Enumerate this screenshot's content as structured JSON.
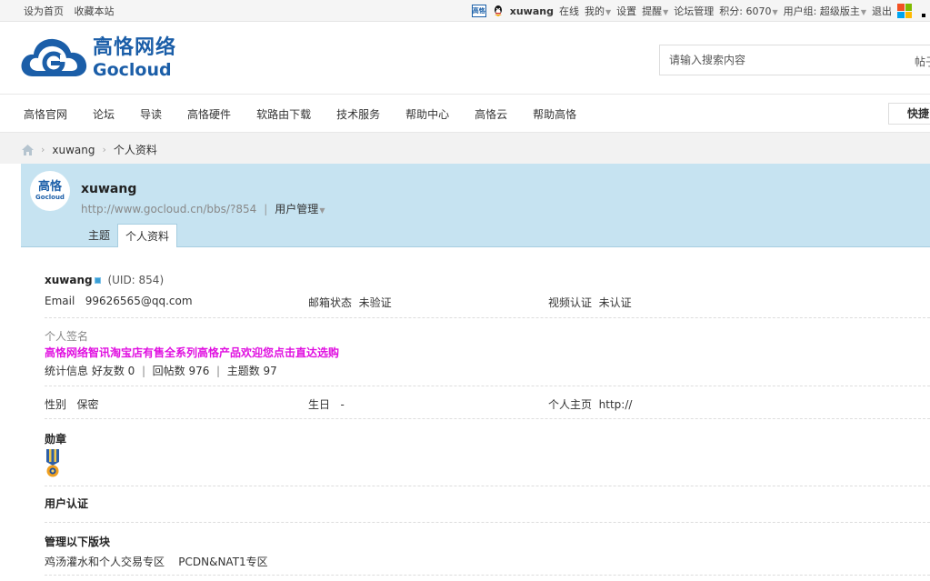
{
  "topbar": {
    "set_home": "设为首页",
    "bookmark": "收藏本站",
    "username": "xuwang",
    "status": "在线",
    "mine": "我的",
    "settings": "设置",
    "remind": "提醒",
    "forum_admin": "论坛管理",
    "points": "积分: 6070",
    "user_group": "用户组: 超级版主",
    "logout": "退出"
  },
  "header": {
    "logo_cn": "高恪网络",
    "logo_en": "Gocloud",
    "reg_mark": "®",
    "search_placeholder": "请输入搜索内容",
    "search_scope": "帖子"
  },
  "nav": {
    "items": [
      "高恪官网",
      "论坛",
      "导读",
      "高恪硬件",
      "软路由下载",
      "技术服务",
      "帮助中心",
      "高恪云",
      "帮助高恪"
    ],
    "quick": "快捷"
  },
  "breadcrumb": {
    "user": "xuwang",
    "page": "个人资料"
  },
  "profile_header": {
    "avatar_cn": "高恪",
    "avatar_en": "Gocloud",
    "name": "xuwang",
    "url": "http://www.gocloud.cn/bbs/?854",
    "manage": "用户管理",
    "tabs": [
      "主题",
      "个人资料"
    ],
    "active_tab": "个人资料"
  },
  "profile": {
    "username": "xuwang",
    "uid": "(UID: 854)",
    "email_label": "Email",
    "email": "99626565@qq.com",
    "email_status_label": "邮箱状态",
    "email_status": "未验证",
    "video_label": "视频认证",
    "video_status": "未认证",
    "signature_label": "个人签名",
    "signature": "高恪网络智讯淘宝店有售全系列高恪产品欢迎您点击直达选购",
    "stats_label": "统计信息",
    "friends": "好友数 0",
    "replies": "回帖数 976",
    "topics": "主题数 97",
    "gender_label": "性别",
    "gender": "保密",
    "birthday_label": "生日",
    "birthday": "-",
    "homepage_label": "个人主页",
    "homepage": "http://",
    "medals_label": "勋章",
    "cert_label": "用户认证",
    "manage_label": "管理以下版块",
    "managed_forums": "鸡汤灌水和个人交易专区    PCDN&NAT1专区"
  },
  "colors": {
    "brand": "#1b5ea8",
    "profile_bg": "#c6e3f1",
    "signature": "#e010e0"
  }
}
